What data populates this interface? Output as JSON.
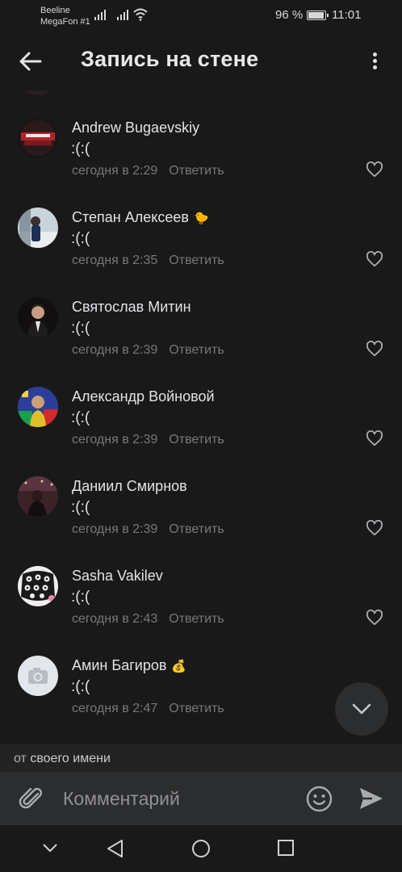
{
  "status_bar": {
    "carrier_1": "Beeline",
    "carrier_2": "MegaFon #1",
    "battery": "96 %",
    "battery_level": 0.96,
    "time": "11:01"
  },
  "header": {
    "title": "Запись на стене",
    "back_icon": "arrow-left-icon",
    "menu_icon": "more-vertical-icon"
  },
  "comments": [
    {
      "author": "Andrew Bugaevskiy",
      "emoji": "",
      "text": ":(:(",
      "time": "сегодня в 2:29",
      "reply_label": "Ответить"
    },
    {
      "author": "Степан Алексеев",
      "emoji": "🐤",
      "text": ":(:(",
      "time": "сегодня в 2:35",
      "reply_label": "Ответить"
    },
    {
      "author": "Святослав Митин",
      "emoji": "",
      "text": ":(:(",
      "time": "сегодня в 2:39",
      "reply_label": "Ответить"
    },
    {
      "author": "Александр Войновой",
      "emoji": "",
      "text": ":(:(",
      "time": "сегодня в 2:39",
      "reply_label": "Ответить"
    },
    {
      "author": "Даниил Смирнов",
      "emoji": "",
      "text": ":(:(",
      "time": "сегодня в 2:39",
      "reply_label": "Ответить"
    },
    {
      "author": "Sasha Vakilev",
      "emoji": "",
      "text": ":(:(",
      "time": "сегодня в 2:43",
      "reply_label": "Ответить"
    },
    {
      "author": "Амин Багиров",
      "emoji": "💰",
      "text": ":(:(",
      "time": "сегодня в 2:47",
      "reply_label": "Ответить"
    }
  ],
  "from_bar": {
    "prefix": "от",
    "name": "своего имени"
  },
  "composer": {
    "placeholder": "Комментарий"
  },
  "colors": {
    "background": "#19191a",
    "secondary_text": "#76787a",
    "composer_bg": "#2c2d2e"
  }
}
